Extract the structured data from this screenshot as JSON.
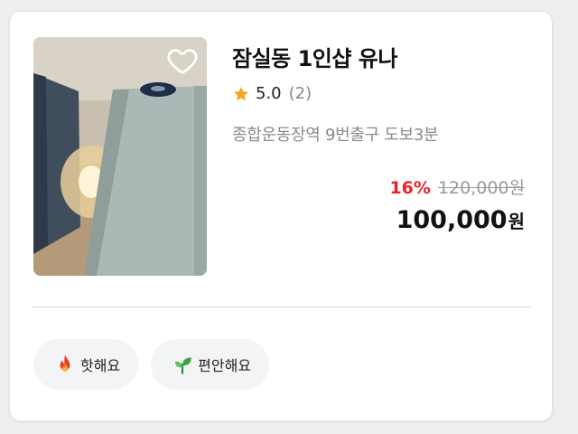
{
  "listing": {
    "title": "잠실동 1인샵 유나",
    "rating": {
      "score": "5.0",
      "count": "(2)"
    },
    "location": "종합운동장역 9번출구 도보3분",
    "price": {
      "discount": "16%",
      "original": "120,000원",
      "final": "100,000",
      "currency": "원"
    },
    "favorite_icon": "heart-outline-icon",
    "rating_icon": "star-icon"
  },
  "tags": [
    {
      "label": "핫해요",
      "icon": "fire-icon"
    },
    {
      "label": "편안해요",
      "icon": "sprout-icon"
    }
  ],
  "colors": {
    "discount": "#e8232d",
    "star": "#f5a623",
    "muted_text": "#8a8a8a",
    "tag_background": "#f3f4f6"
  }
}
